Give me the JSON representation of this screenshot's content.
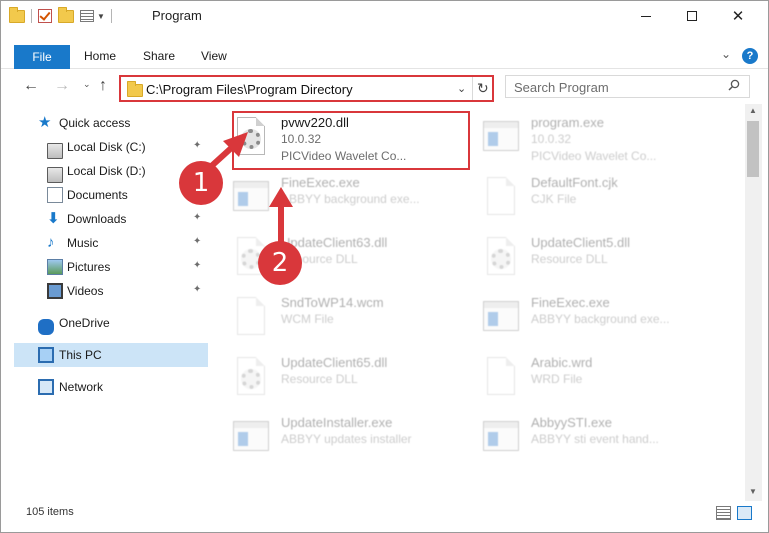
{
  "window": {
    "title": "Program",
    "min_icon": "minimize-icon",
    "max_icon": "maximize-icon",
    "close_glyph": "✕"
  },
  "ribbon": {
    "file": "File",
    "home": "Home",
    "share": "Share",
    "view": "View",
    "expand_glyph": "⌄",
    "help_glyph": "?"
  },
  "address": {
    "path": "C:\\Program Files\\Program Directory",
    "chevron": "⌄",
    "refresh_glyph": "↻"
  },
  "nav": {
    "back": "←",
    "forward": "→",
    "recent": "⌄",
    "up": "↑"
  },
  "search": {
    "placeholder": "Search Program"
  },
  "sidebar": {
    "items": [
      {
        "label": "Quick access",
        "icon": "star-icon",
        "glyph": "★"
      },
      {
        "label": "Local Disk (C:)",
        "icon": "drive-icon",
        "pinned": true
      },
      {
        "label": "Local Disk (D:)",
        "icon": "drive-icon"
      },
      {
        "label": "Documents",
        "icon": "documents-icon"
      },
      {
        "label": "Downloads",
        "icon": "download-icon",
        "glyph": "⬇",
        "pinned": true
      },
      {
        "label": "Music",
        "icon": "music-icon",
        "glyph": "♪",
        "pinned": true
      },
      {
        "label": "Pictures",
        "icon": "pictures-icon",
        "pinned": true
      },
      {
        "label": "Videos",
        "icon": "videos-icon",
        "pinned": true
      },
      {
        "label": "OneDrive",
        "icon": "cloud-icon"
      },
      {
        "label": "This PC",
        "icon": "computer-icon",
        "selected": true
      },
      {
        "label": "Network",
        "icon": "network-icon"
      }
    ],
    "pin_glyph": "📌"
  },
  "files": [
    {
      "name": "pvwv220.dll",
      "type": "10.0.32",
      "desc": "PICVideo Wavelet Co...",
      "kind": "dll",
      "highlighted": true
    },
    {
      "name": "program.exe",
      "type": "10.0.32",
      "desc": "PICVideo Wavelet Co...",
      "kind": "exe"
    },
    {
      "name": "FineExec.exe",
      "type": "ABBYY background exe...",
      "kind": "exe"
    },
    {
      "name": "DefaultFont.cjk",
      "type": "CJK File",
      "kind": "doc"
    },
    {
      "name": "UpdateClient63.dll",
      "type": "Resource DLL",
      "kind": "dll"
    },
    {
      "name": "UpdateClient5.dll",
      "type": "Resource DLL",
      "kind": "dll"
    },
    {
      "name": "SndToWP14.wcm",
      "type": "WCM File",
      "kind": "doc"
    },
    {
      "name": "FineExec.exe",
      "type": "ABBYY background exe...",
      "kind": "exe"
    },
    {
      "name": "UpdateClient65.dll",
      "type": "Resource DLL",
      "kind": "dll"
    },
    {
      "name": "Arabic.wrd",
      "type": "WRD File",
      "kind": "doc"
    },
    {
      "name": "UpdateInstaller.exe",
      "type": "ABBYY updates installer",
      "kind": "exe"
    },
    {
      "name": "AbbyySTI.exe",
      "type": "ABBYY sti event hand...",
      "kind": "exe"
    }
  ],
  "callouts": {
    "one": "1",
    "two": "2"
  },
  "scroll": {
    "up": "▲",
    "down": "▼"
  },
  "status": {
    "count": "105 items"
  },
  "colors": {
    "accent": "#1979ca",
    "annotation": "#d9373b",
    "selected": "#cce4f7"
  }
}
